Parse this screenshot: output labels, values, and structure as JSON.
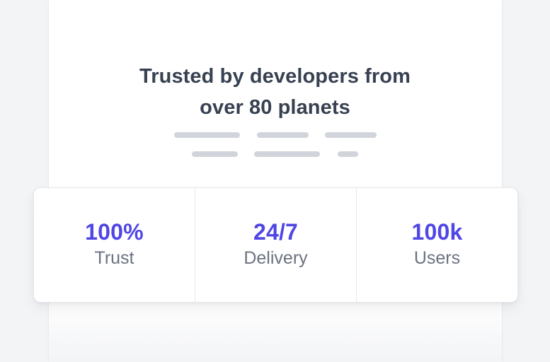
{
  "hero": {
    "title_line_1": "Trusted by developers from",
    "title_line_2": "over 80 planets",
    "placeholder_lines": 6
  },
  "stats": [
    {
      "value": "100%",
      "label": "Trust"
    },
    {
      "value": "24/7",
      "label": "Delivery"
    },
    {
      "value": "100k",
      "label": "Users"
    }
  ],
  "colors": {
    "accent": "#4f46e5",
    "heading": "#374151",
    "muted": "#6b7280",
    "placeholder": "#d1d5db",
    "background": "#f3f4f6"
  }
}
